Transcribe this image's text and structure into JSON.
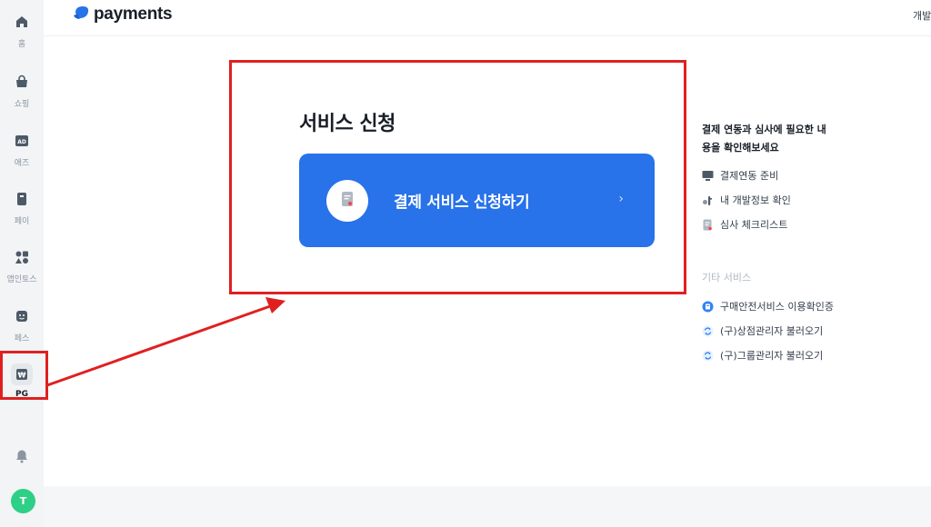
{
  "sidebar": {
    "items": [
      {
        "label": "홈",
        "icon": "home-icon"
      },
      {
        "label": "쇼핑",
        "icon": "shopping-bag-icon"
      },
      {
        "label": "애즈",
        "icon": "ad-icon"
      },
      {
        "label": "페이",
        "icon": "pay-icon"
      },
      {
        "label": "앱인토스",
        "icon": "apps-icon"
      },
      {
        "label": "페스",
        "icon": "face-icon"
      },
      {
        "label": "PG",
        "icon": "won-icon"
      }
    ],
    "avatar_initial": "T"
  },
  "header": {
    "logo_text": "payments",
    "right_text": "개발"
  },
  "main": {
    "title": "서비스 신청",
    "apply_button_label": "결제 서비스 신청하기",
    "chevron": "›"
  },
  "right_panel": {
    "guide_title": "결제 연동과 심사에 필요한 내용을 확인해보세요",
    "guide_links": [
      "결제연동 준비",
      "내 개발정보 확인",
      "심사 체크리스트"
    ],
    "other_title": "기타 서비스",
    "other_links": [
      "구매안전서비스 이용확인증",
      "(구)상점관리자 불러오기",
      "(구)그룹관리자 불러오기"
    ]
  },
  "colors": {
    "accent": "#2872ea",
    "annotation": "#e02020",
    "avatar": "#2ecf86"
  }
}
